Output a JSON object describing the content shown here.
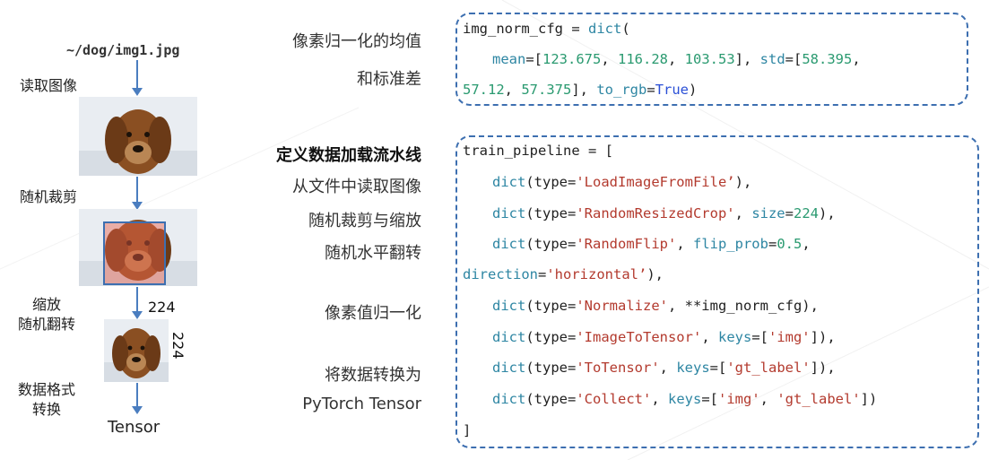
{
  "left": {
    "path": "~/dog/img1.jpg",
    "steps": [
      "读取图像",
      "随机裁剪"
    ],
    "resize_label": [
      "缩放",
      "随机翻转"
    ],
    "size_w": "224",
    "size_h": "224",
    "format_label": [
      "数据格式",
      "转换"
    ],
    "output": "Tensor"
  },
  "notes": {
    "norm_line1": "像素归一化的均值",
    "norm_line2": "和标准差",
    "pipeline_title": "定义数据加载流水线",
    "load": "从文件中读取图像",
    "crop": "随机裁剪与缩放",
    "flip": "随机水平翻转",
    "normalize": "像素值归一化",
    "convert_line1": "将数据转换为",
    "convert_line2": "PyTorch Tensor"
  },
  "code1": {
    "var": "img_norm_cfg = ",
    "dict": "dict",
    "open": "(",
    "mean_kw": "mean",
    "eq_open": "=[",
    "m1": "123.675",
    "m2": "116.28",
    "m3": "103.53",
    "sep": ", ",
    "close_sep": "], ",
    "std_kw": "std",
    "s1": "58.395",
    "s2": "57.12",
    "s3": "57.375",
    "torgb_kw": "to_rgb",
    "eq": "=",
    "true_val": "True",
    "close": ")"
  },
  "code2": {
    "head": "train_pipeline = [",
    "dict": "dict",
    "open_type": "(type=",
    "load": "'LoadImageFromFile’",
    "crop": "'RandomResizedCrop'",
    "size_kw": "size",
    "size_val": "224",
    "flip": "'RandomFlip'",
    "flip_prob_kw": "flip_prob",
    "flip_prob_val": "0.5",
    "direction_kw": "direction",
    "direction_val": "'horizontal’",
    "normalize": "'Normalize'",
    "norm_rest": ", **img_norm_cfg),",
    "totensor_img": "'ImageToTensor'",
    "keys_kw": "keys",
    "img_key": "'img'",
    "totensor": "'ToTensor'",
    "gt_key": "'gt_label'",
    "collect": "'Collect'",
    "foot": "]"
  },
  "colors": {
    "accent_blue": "#3d6fb0",
    "keyword": "#2e86a3",
    "string": "#b33a2e",
    "number": "#2a9a70"
  }
}
